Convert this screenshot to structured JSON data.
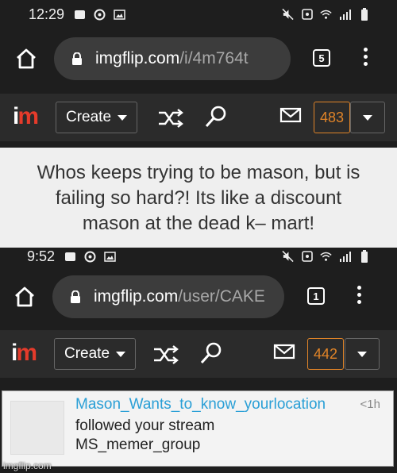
{
  "top": {
    "status": {
      "time": "12:29"
    },
    "url": {
      "domain": "imgflip.com",
      "path": "/i/4m764t"
    },
    "tab_count": "5",
    "nav": {
      "logo_i": "i",
      "logo_m": "m",
      "create_label": "Create",
      "notification_count": "483"
    }
  },
  "caption": {
    "line1": "Whos keeps trying to be mason, but is",
    "line2": "failing so hard?! Its like a discount",
    "line3": "mason at the dead k– mart!"
  },
  "bottom": {
    "status": {
      "time": "9:52"
    },
    "url": {
      "domain": "imgflip.com",
      "path": "/user/CAKE"
    },
    "tab_count": "1",
    "nav": {
      "logo_i": "i",
      "logo_m": "m",
      "create_label": "Create",
      "notification_count": "442"
    },
    "notification": {
      "username": "Mason_Wants_to_know_yourlocation",
      "time": "<1h",
      "line1": "followed your stream",
      "line2": "MS_memer_group"
    }
  },
  "watermark": "imgflip.com",
  "colors": {
    "accent_orange": "#e08428",
    "logo_red": "#e53b2b",
    "link_blue": "#2a9fd6"
  }
}
